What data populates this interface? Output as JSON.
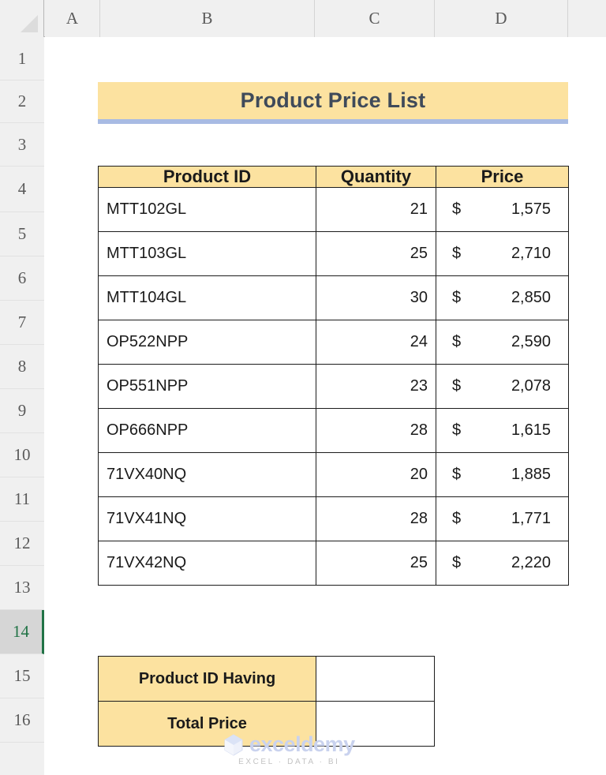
{
  "spreadsheet": {
    "column_headers": [
      "A",
      "B",
      "C",
      "D"
    ],
    "row_headers": [
      "1",
      "2",
      "3",
      "4",
      "5",
      "6",
      "7",
      "8",
      "9",
      "10",
      "11",
      "12",
      "13",
      "14",
      "15",
      "16"
    ],
    "active_row": "14",
    "select_all_icon": "select-all-triangle-icon",
    "accent_color": "#217346"
  },
  "report": {
    "title": "Product Price List",
    "title_fill": "#fce2a0",
    "title_underline": "#a8bbe3",
    "header_fill": "#fce2a0",
    "table": {
      "columns": [
        "Product ID",
        "Quantity",
        "Price"
      ],
      "currency_symbol": "$",
      "rows": [
        {
          "product_id": "MTT102GL",
          "quantity": "21",
          "price": "1,575"
        },
        {
          "product_id": "MTT103GL",
          "quantity": "25",
          "price": "2,710"
        },
        {
          "product_id": "MTT104GL",
          "quantity": "30",
          "price": "2,850"
        },
        {
          "product_id": "OP522NPP",
          "quantity": "24",
          "price": "2,590"
        },
        {
          "product_id": "OP551NPP",
          "quantity": "23",
          "price": "2,078"
        },
        {
          "product_id": "OP666NPP",
          "quantity": "28",
          "price": "1,615"
        },
        {
          "product_id": "71VX40NQ",
          "quantity": "20",
          "price": "1,885"
        },
        {
          "product_id": "71VX41NQ",
          "quantity": "28",
          "price": "1,771"
        },
        {
          "product_id": "71VX42NQ",
          "quantity": "25",
          "price": "2,220"
        }
      ]
    },
    "criteria": {
      "rows": [
        {
          "label": "Product ID Having",
          "value": ""
        },
        {
          "label": "Total Price",
          "value": ""
        }
      ]
    }
  },
  "watermark": {
    "word": "exceldemy",
    "tagline": "EXCEL  ·  DATA  ·  BI"
  }
}
